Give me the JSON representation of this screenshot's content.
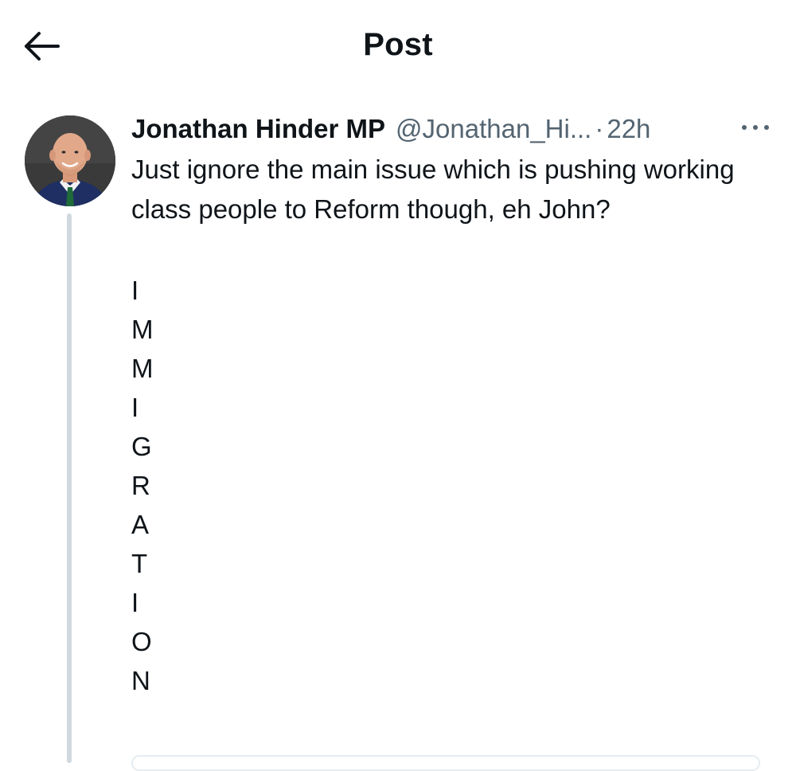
{
  "header": {
    "title": "Post"
  },
  "icons": {
    "back": "arrow-left-icon",
    "more": "more-horizontal-icon",
    "avatar": "profile-photo"
  },
  "post": {
    "author_name": "Jonathan Hinder MP",
    "handle": "@Jonathan_Hi...",
    "separator": "·",
    "time": "22h",
    "text": "Just ignore the main issue which is pushing working class people to Reform though, eh John?",
    "vertical_letters": [
      "I",
      "M",
      "M",
      "I",
      "G",
      "R",
      "A",
      "T",
      "I",
      "O",
      "N"
    ]
  },
  "colors": {
    "text_primary": "#0f1419",
    "text_secondary": "#536471",
    "thread_line": "#cfd9de"
  }
}
